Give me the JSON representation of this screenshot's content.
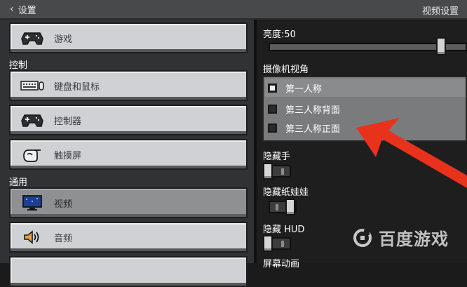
{
  "topbar": {
    "back_label": "设置",
    "title": "视频设置"
  },
  "left": {
    "items": [
      {
        "label": "游戏",
        "icon": "gamepad-icon"
      },
      {
        "label": "键盘和鼠标",
        "icon": "keyboard-mouse-icon"
      },
      {
        "label": "控制器",
        "icon": "gamepad-icon"
      },
      {
        "label": "触摸屏",
        "icon": "touch-hand-icon"
      },
      {
        "label": "视频",
        "icon": "monitor-icon"
      },
      {
        "label": "音频",
        "icon": "speaker-icon"
      }
    ],
    "sections": {
      "controls": "控制",
      "general": "通用"
    },
    "selected_item": "视频"
  },
  "right": {
    "brightness_label": "亮度:50",
    "brightness_value": 50,
    "camera_label": "摄像机视角",
    "camera_options": [
      "第一人称",
      "第三人称背面",
      "第三人称正面"
    ],
    "camera_selected": "第一人称",
    "hide_hand_label": "隐藏手",
    "hide_hand": false,
    "hide_paperdoll_label": "隐藏纸娃娃",
    "hide_paperdoll": true,
    "hide_hud_label": "隐藏 HUD",
    "hide_hud": false,
    "screen_anim_label": "屏幕动画"
  },
  "overlay": {
    "watermark_text": "百度游戏",
    "arrow_color": "#e8321c"
  },
  "colors": {
    "selected_button": "#8f9091",
    "button": "#d0d1d4",
    "background": "#1e1e1f"
  }
}
